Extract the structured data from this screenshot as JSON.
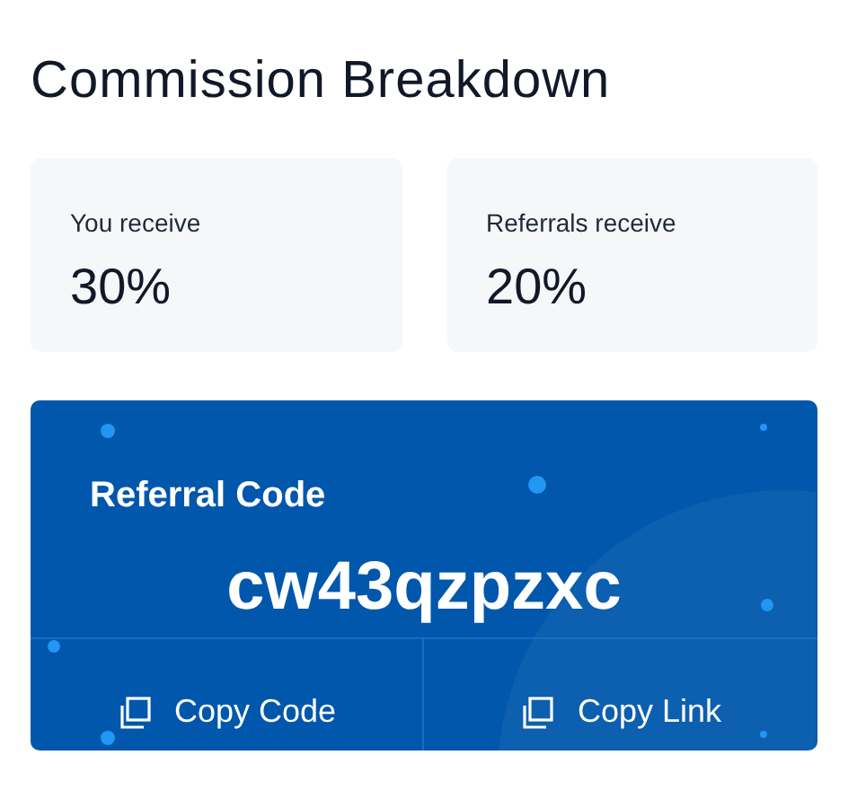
{
  "title": "Commission Breakdown",
  "stats": [
    {
      "label": "You receive",
      "value": "30%"
    },
    {
      "label": "Referrals receive",
      "value": "20%"
    }
  ],
  "referral": {
    "title": "Referral Code",
    "code": "cw43qzpzxc",
    "actions": [
      "Copy Code",
      "Copy Link"
    ]
  }
}
